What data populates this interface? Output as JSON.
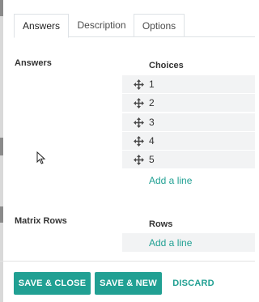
{
  "tabs": [
    {
      "label": "Answers",
      "active": true
    },
    {
      "label": "Description",
      "active": false
    },
    {
      "label": "Options",
      "active": false
    }
  ],
  "answers_section": {
    "label": "Answers",
    "column_header": "Choices",
    "choices": [
      "1",
      "2",
      "3",
      "4",
      "5"
    ],
    "add_line": "Add a line"
  },
  "matrix_section": {
    "label": "Matrix Rows",
    "column_header": "Rows",
    "add_line": "Add a line"
  },
  "footer": {
    "save_close": "SAVE & CLOSE",
    "save_new": "SAVE & NEW",
    "discard": "DISCARD"
  },
  "colors": {
    "accent": "#21a093",
    "row_bg": "#f2f3f4"
  },
  "icons": {
    "drag_handle": "arrows-move-icon",
    "cursor": "mouse-pointer-icon"
  }
}
